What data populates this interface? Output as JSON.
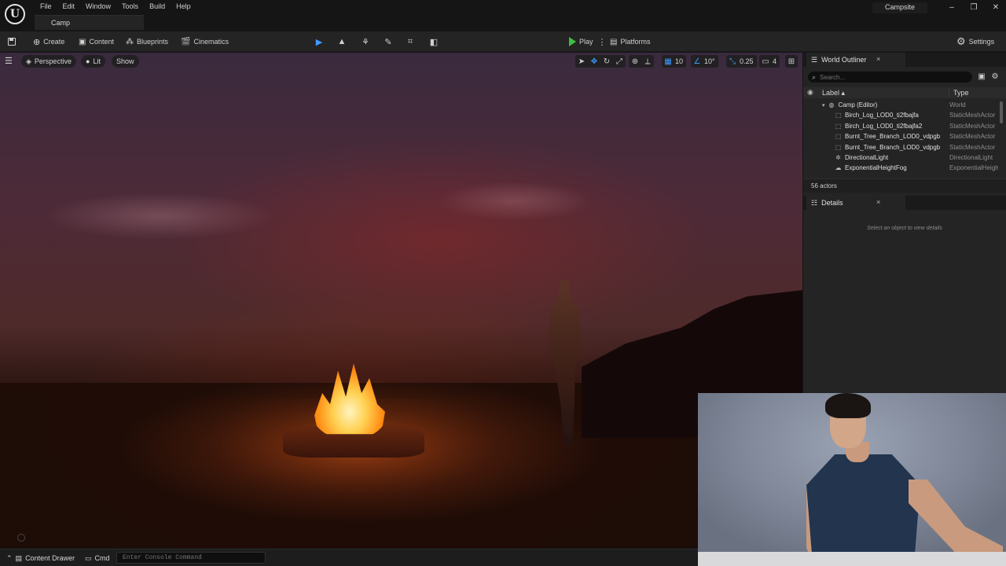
{
  "app": {
    "logo": "U",
    "menu": [
      "File",
      "Edit",
      "Window",
      "Tools",
      "Build",
      "Help"
    ],
    "level_tab": "Camp",
    "project_name": "Campsite",
    "window_controls": {
      "minimize": "–",
      "restore": "❐",
      "close": "✕"
    }
  },
  "toolbar": {
    "create": "Create",
    "content": "Content",
    "blueprints": "Blueprints",
    "cinematics": "Cinematics",
    "play": "Play",
    "platforms": "Platforms",
    "settings": "Settings",
    "accent_color": "#3c9cff",
    "play_color": "#3fbf3f"
  },
  "viewport": {
    "perspective": "Perspective",
    "lit": "Lit",
    "show": "Show",
    "grid_snap": "10",
    "rotation_snap": "10°",
    "scale_snap": "0.25",
    "camera_speed": "4"
  },
  "world_outliner": {
    "title": "World Outliner",
    "close": "×",
    "search_placeholder": "Search...",
    "col_label": "Label ▴",
    "col_type": "Type",
    "items": [
      {
        "label": "Camp (Editor)",
        "type": "World",
        "icon": "world-icon",
        "level": 0
      },
      {
        "label": "Birch_Log_LOD0_ti2fbajfa",
        "type": "StaticMeshActor",
        "icon": "static-mesh-icon",
        "level": 1
      },
      {
        "label": "Birch_Log_LOD0_ti2fbajfa2",
        "type": "StaticMeshActor",
        "icon": "static-mesh-icon",
        "level": 1
      },
      {
        "label": "Burnt_Tree_Branch_LOD0_vdpgb",
        "type": "StaticMeshActor",
        "icon": "static-mesh-icon",
        "level": 1
      },
      {
        "label": "Burnt_Tree_Branch_LOD0_vdpgb",
        "type": "StaticMeshActor",
        "icon": "static-mesh-icon",
        "level": 1
      },
      {
        "label": "DirectionalLight",
        "type": "DirectionalLight",
        "icon": "directional-light-icon",
        "level": 1
      },
      {
        "label": "ExponentialHeightFog",
        "type": "ExponentialHeightFog",
        "icon": "fog-icon",
        "level": 1
      }
    ],
    "actor_count": "56 actors"
  },
  "details": {
    "title": "Details",
    "close": "×",
    "empty_message": "Select an object to view details"
  },
  "statusbar": {
    "content_drawer": "Content Drawer",
    "cmd": "Cmd",
    "console_placeholder": "Enter Console Command"
  }
}
